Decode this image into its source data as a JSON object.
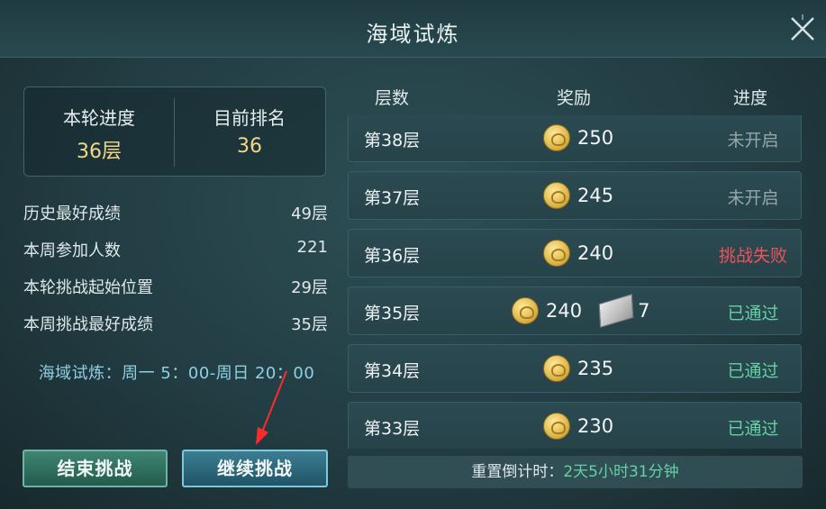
{
  "header": {
    "title": "海域试炼"
  },
  "stats": {
    "progress_label": "本轮进度",
    "progress_value": "36层",
    "rank_label": "目前排名",
    "rank_value": "36"
  },
  "info_rows": [
    {
      "label": "历史最好成绩",
      "value": "49层"
    },
    {
      "label": "本周参加人数",
      "value": "221"
    },
    {
      "label": "本轮挑战起始位置",
      "value": "29层"
    },
    {
      "label": "本周挑战最好成绩",
      "value": "35层"
    }
  ],
  "schedule": "海域试炼：周一 5：00-周日 20：00",
  "buttons": {
    "end": "结束挑战",
    "continue": "继续挑战"
  },
  "table": {
    "headers": {
      "floor": "层数",
      "reward": "奖励",
      "progress": "进度"
    },
    "rows": [
      {
        "floor": "第38层",
        "coins": "250",
        "item_count": "",
        "status": "未开启",
        "state": "locked"
      },
      {
        "floor": "第37层",
        "coins": "245",
        "item_count": "",
        "status": "未开启",
        "state": "locked"
      },
      {
        "floor": "第36层",
        "coins": "240",
        "item_count": "",
        "status": "挑战失败",
        "state": "failed"
      },
      {
        "floor": "第35层",
        "coins": "240",
        "item_count": "7",
        "status": "已通过",
        "state": "passed"
      },
      {
        "floor": "第34层",
        "coins": "235",
        "item_count": "",
        "status": "已通过",
        "state": "passed"
      },
      {
        "floor": "第33层",
        "coins": "230",
        "item_count": "",
        "status": "已通过",
        "state": "passed"
      }
    ]
  },
  "reset": {
    "label": "重置倒计时：",
    "time": "2天5小时31分钟"
  },
  "colors": {
    "gold": "#f2d78a",
    "passed": "#64d1a4",
    "failed": "#f0525a",
    "locked": "#93a7ab",
    "schedule": "#8fd1e3"
  }
}
